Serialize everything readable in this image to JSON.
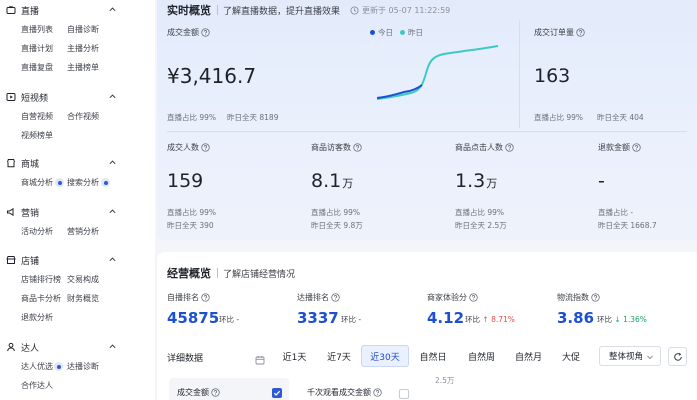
{
  "sidebar": {
    "sections": [
      {
        "title": "直播",
        "icon": "live-icon",
        "items": [
          "直播列表",
          "自播诊断",
          "直播计划",
          "主播分析",
          "直播复盘",
          "主播榜单"
        ]
      },
      {
        "title": "短视频",
        "icon": "video-icon",
        "items": [
          "自营视频",
          "合作视频",
          "视频榜单"
        ]
      },
      {
        "title": "商城",
        "icon": "shop-icon",
        "items": [
          "商城分析",
          "搜索分析"
        ]
      },
      {
        "title": "营销",
        "icon": "marketing-icon",
        "items": [
          "活动分析",
          "营销分析"
        ]
      },
      {
        "title": "店铺",
        "icon": "store-icon",
        "items": [
          "店铺排行榜",
          "交易构成",
          "商品卡分析",
          "财务概览",
          "退款分析"
        ]
      },
      {
        "title": "达人",
        "icon": "creator-icon",
        "items": [
          "达人优选",
          "达播诊断",
          "合作达人"
        ]
      }
    ]
  },
  "realtime": {
    "title": "实时概览",
    "desc": "了解直播数据，提升直播效果",
    "updated": "更新于 05-07 11:22:59",
    "legend": {
      "today": "今日",
      "yesterday": "昨日"
    },
    "colors": {
      "today": "#1e4fd0",
      "yesterday": "#3ec9c4"
    },
    "gmv": {
      "label": "成交金额",
      "value": "¥3,416.7",
      "ratio": "直播占比 99%",
      "yday": "昨日全天 8189"
    },
    "orders": {
      "label": "成交订单量",
      "value": "163",
      "ratio": "直播占比 99%",
      "yday": "昨日全天 404"
    },
    "metrics": [
      {
        "label": "成交人数",
        "value": "159",
        "unit": "",
        "ratio": "直播占比 99%",
        "yday": "昨日全天 390"
      },
      {
        "label": "商品访客数",
        "value": "8.1",
        "unit": "万",
        "ratio": "直播占比 99%",
        "yday": "昨日全天 9.8万"
      },
      {
        "label": "商品点击人数",
        "value": "1.3",
        "unit": "万",
        "ratio": "直播占比 99%",
        "yday": "昨日全天 2.5万"
      },
      {
        "label": "退款金额",
        "value": "-",
        "unit": "",
        "ratio": "直播占比 -",
        "yday": "昨日全天 1668.7"
      }
    ]
  },
  "ops": {
    "title": "经营概览",
    "desc": "了解店铺经营情况",
    "kpis": [
      {
        "label": "自播排名",
        "value": "45875",
        "ring_label": "环比",
        "ring_value": "-",
        "dir": ""
      },
      {
        "label": "达播排名",
        "value": "3337",
        "ring_label": "环比",
        "ring_value": "-",
        "dir": ""
      },
      {
        "label": "商家体验分",
        "value": "4.12",
        "ring_label": "环比",
        "ring_value": "8.71%",
        "dir": "up"
      },
      {
        "label": "物流指数",
        "value": "3.86",
        "ring_label": "环比",
        "ring_value": "1.36%",
        "dir": "down"
      }
    ],
    "detail_label": "详细数据",
    "tabs": [
      "近1天",
      "近7天",
      "近30天",
      "自然日",
      "自然周",
      "自然月",
      "大促"
    ],
    "selected_tab": "近30天",
    "view_select": "整体视角",
    "metric_a": "成交金额",
    "metric_b": "千次观看成交金额",
    "y_label": "2.5万"
  }
}
